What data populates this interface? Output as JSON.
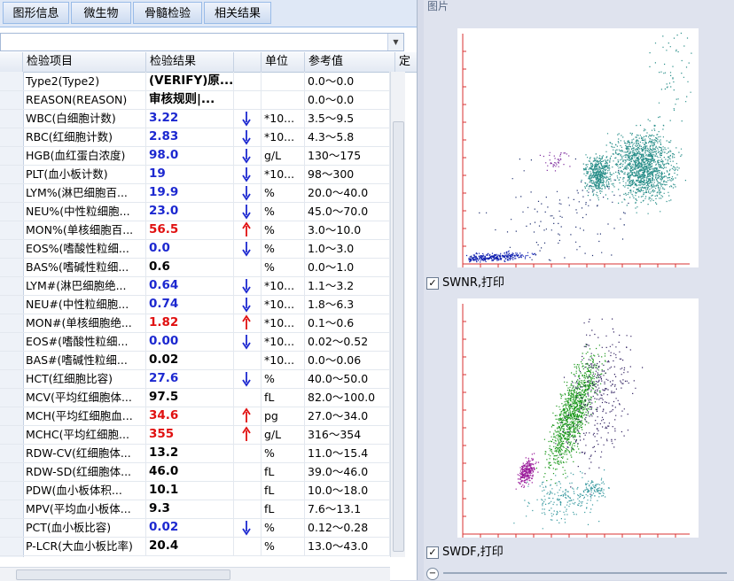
{
  "tabs": [
    "图形信息",
    "微生物",
    "骨髓检验",
    "相关结果"
  ],
  "columns": {
    "item": "检验项目",
    "result": "检验结果",
    "unit": "单位",
    "ref": "参考值",
    "extra": "定"
  },
  "rows": [
    {
      "item": "Type2(Type2)",
      "result": "(VERIFY)原...",
      "color": "black",
      "arrow": "",
      "unit": "",
      "ref": "0.0～0.0"
    },
    {
      "item": "REASON(REASON)",
      "result": "审核规则|...",
      "color": "black",
      "arrow": "",
      "unit": "",
      "ref": "0.0～0.0"
    },
    {
      "item": "WBC(白细胞计数)",
      "result": "3.22",
      "color": "blue",
      "arrow": "down",
      "unit": "*10...",
      "ref": "3.5～9.5"
    },
    {
      "item": "RBC(红细胞计数)",
      "result": "2.83",
      "color": "blue",
      "arrow": "down",
      "unit": "*10...",
      "ref": "4.3～5.8"
    },
    {
      "item": "HGB(血红蛋白浓度)",
      "result": "98.0",
      "color": "blue",
      "arrow": "down",
      "unit": "g/L",
      "ref": "130～175"
    },
    {
      "item": "PLT(血小板计数)",
      "result": "19",
      "color": "blue",
      "arrow": "down",
      "unit": "*10...",
      "ref": "98～300"
    },
    {
      "item": "LYM%(淋巴细胞百...",
      "result": "19.9",
      "color": "blue",
      "arrow": "down",
      "unit": "%",
      "ref": "20.0～40.0"
    },
    {
      "item": "NEU%(中性粒细胞...",
      "result": "23.0",
      "color": "blue",
      "arrow": "down",
      "unit": "%",
      "ref": "45.0～70.0"
    },
    {
      "item": "MON%(单核细胞百...",
      "result": "56.5",
      "color": "red",
      "arrow": "up",
      "unit": "%",
      "ref": "3.0～10.0"
    },
    {
      "item": "EOS%(嗜酸性粒细...",
      "result": "0.0",
      "color": "blue",
      "arrow": "down",
      "unit": "%",
      "ref": "1.0～3.0"
    },
    {
      "item": "BAS%(嗜碱性粒细...",
      "result": "0.6",
      "color": "black",
      "arrow": "",
      "unit": "%",
      "ref": "0.0～1.0"
    },
    {
      "item": "LYM#(淋巴细胞绝...",
      "result": "0.64",
      "color": "blue",
      "arrow": "down",
      "unit": "*10...",
      "ref": "1.1～3.2"
    },
    {
      "item": "NEU#(中性粒细胞...",
      "result": "0.74",
      "color": "blue",
      "arrow": "down",
      "unit": "*10...",
      "ref": "1.8～6.3"
    },
    {
      "item": "MON#(单核细胞绝...",
      "result": "1.82",
      "color": "red",
      "arrow": "up",
      "unit": "*10...",
      "ref": "0.1～0.6"
    },
    {
      "item": "EOS#(嗜酸性粒细...",
      "result": "0.00",
      "color": "blue",
      "arrow": "down",
      "unit": "*10...",
      "ref": "0.02～0.52"
    },
    {
      "item": "BAS#(嗜碱性粒细...",
      "result": "0.02",
      "color": "black",
      "arrow": "",
      "unit": "*10...",
      "ref": "0.0～0.06"
    },
    {
      "item": "HCT(红细胞比容)",
      "result": "27.6",
      "color": "blue",
      "arrow": "down",
      "unit": "%",
      "ref": "40.0～50.0"
    },
    {
      "item": "MCV(平均红细胞体...",
      "result": "97.5",
      "color": "black",
      "arrow": "",
      "unit": "fL",
      "ref": "82.0～100.0"
    },
    {
      "item": "MCH(平均红细胞血...",
      "result": "34.6",
      "color": "red",
      "arrow": "up",
      "unit": "pg",
      "ref": "27.0～34.0"
    },
    {
      "item": "MCHC(平均红细胞...",
      "result": "355",
      "color": "red",
      "arrow": "up",
      "unit": "g/L",
      "ref": "316～354"
    },
    {
      "item": "RDW-CV(红细胞体...",
      "result": "13.2",
      "color": "black",
      "arrow": "",
      "unit": "%",
      "ref": "11.0～15.4"
    },
    {
      "item": "RDW-SD(红细胞体...",
      "result": "46.0",
      "color": "black",
      "arrow": "",
      "unit": "fL",
      "ref": "39.0～46.0"
    },
    {
      "item": "PDW(血小板体积...",
      "result": "10.1",
      "color": "black",
      "arrow": "",
      "unit": "fL",
      "ref": "10.0～18.0"
    },
    {
      "item": "MPV(平均血小板体...",
      "result": "9.3",
      "color": "black",
      "arrow": "",
      "unit": "fL",
      "ref": "7.6～13.1"
    },
    {
      "item": "PCT(血小板比容)",
      "result": "0.02",
      "color": "blue",
      "arrow": "down",
      "unit": "%",
      "ref": "0.12～0.28"
    },
    {
      "item": "P-LCR(大血小板比率)",
      "result": "20.4",
      "color": "black",
      "arrow": "",
      "unit": "%",
      "ref": "13.0～43.0"
    }
  ],
  "right_panel": {
    "title": "图片",
    "plot1_checkbox": "SWNR,打印",
    "plot2_checkbox": "SWDF,打印",
    "checked_mark": "✓"
  },
  "colors": {
    "result_blue": "#1c28d0",
    "result_red": "#e01010",
    "axis_red": "#d83030"
  }
}
